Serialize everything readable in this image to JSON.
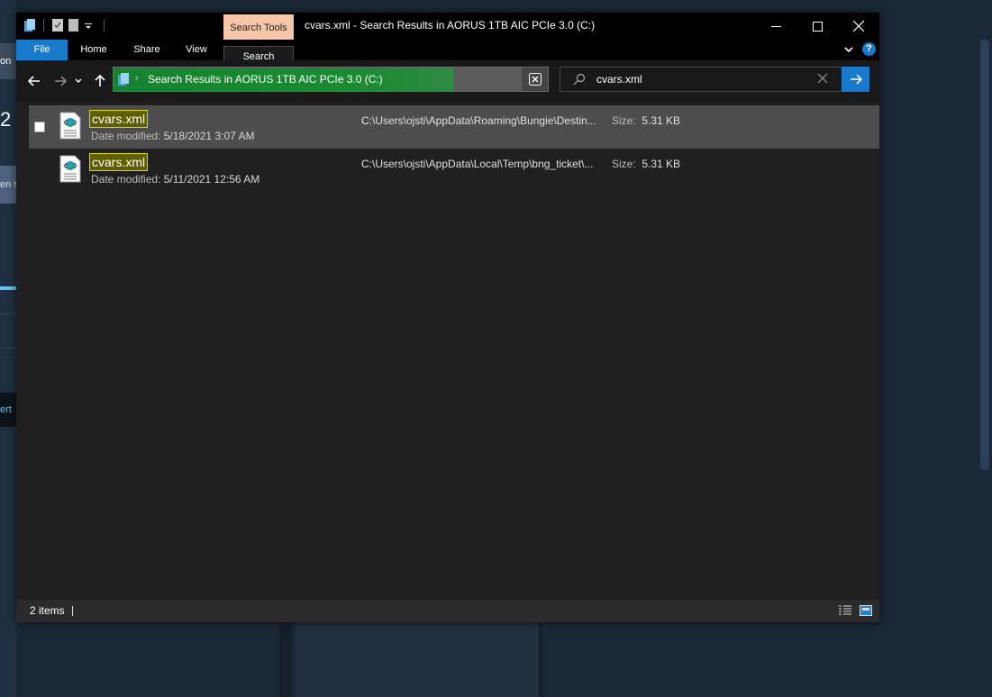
{
  "background_app": {
    "tab_text": "on",
    "number_text": "2",
    "button_text": "en s",
    "selected_text": "ert"
  },
  "window": {
    "title": "cvars.xml - Search Results in AORUS 1TB AIC PCIe 3.0 (C:)",
    "context_tab": "Search Tools"
  },
  "ribbon": {
    "tabs": [
      "File",
      "Home",
      "Share",
      "View",
      "Search"
    ]
  },
  "address_bar": {
    "path": "Search Results in AORUS 1TB AIC PCIe 3.0 (C:)"
  },
  "search": {
    "value": "cvars.xml",
    "placeholder": ""
  },
  "results": [
    {
      "name": "cvars.xml",
      "date_label": "Date modified:",
      "date": "5/18/2021 3:07 AM",
      "path": "C:\\Users\\ojsti\\AppData\\Roaming\\Bungie\\Destin...",
      "size_label": "Size:",
      "size": "5.31 KB",
      "selected": true
    },
    {
      "name": "cvars.xml",
      "date_label": "Date modified:",
      "date": "5/11/2021 12:56 AM",
      "path": "C:\\Users\\ojsti\\AppData\\Local\\Temp\\bng_ticket\\...",
      "size_label": "Size:",
      "size": "5.31 KB",
      "selected": false
    }
  ],
  "status_bar": {
    "count": "2 items"
  },
  "colors": {
    "accent": "#1979ca",
    "progress": "#15832f",
    "highlight": "#d9d900",
    "context_tab": "#f7c6a8"
  }
}
